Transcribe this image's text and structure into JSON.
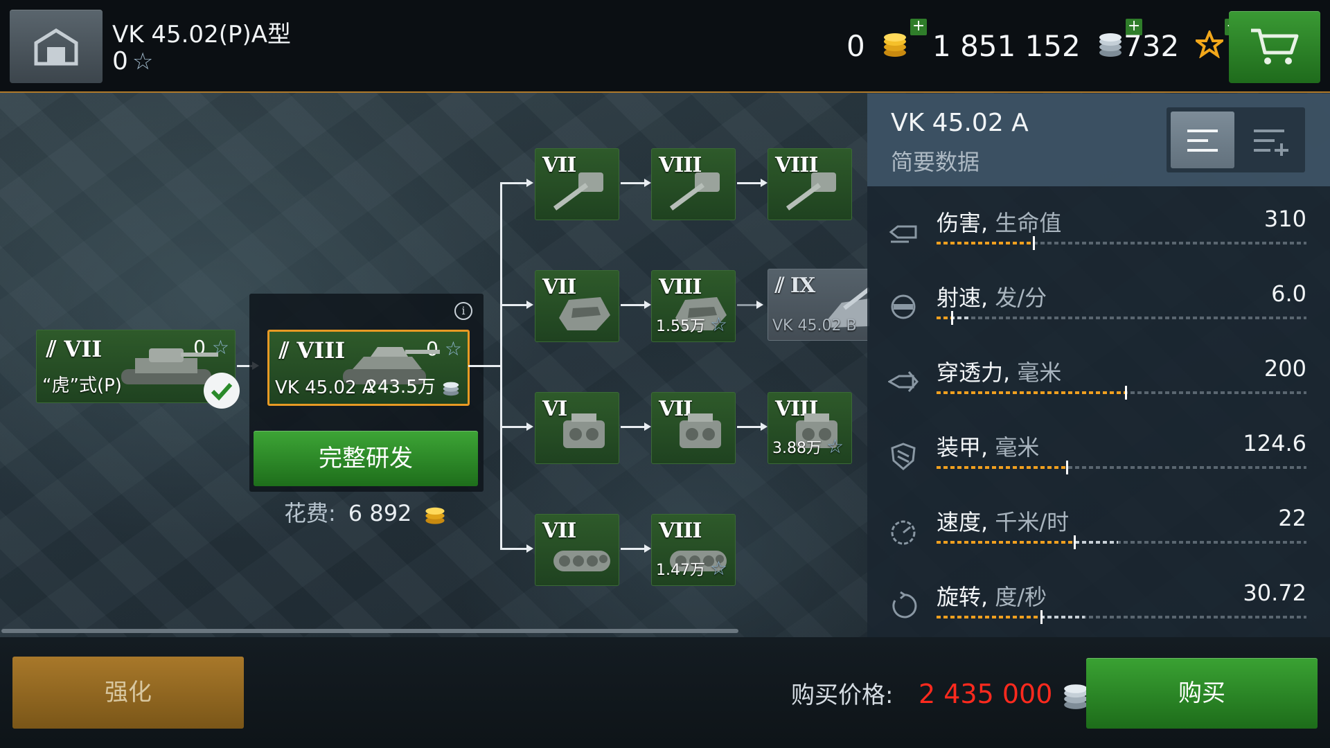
{
  "header": {
    "vehicle_title": "VK 45.02(P)A型",
    "vehicle_xp": "0",
    "gold": "0",
    "credits": "1 851 152",
    "free_xp": "732",
    "plus": "+"
  },
  "tree": {
    "prev_tank": {
      "tier": "VII",
      "name": "“虎”式(P)",
      "xp": "0"
    },
    "current_tank": {
      "tier": "VIII",
      "name": "VK 45.02 A",
      "xp": "0",
      "cost": "243.5万"
    },
    "research_button": "完整研发",
    "cost_label": "花费:",
    "cost_value": "6 892",
    "info": "i",
    "modules": {
      "gun_1": {
        "tier": "VII"
      },
      "gun_2": {
        "tier": "VIII"
      },
      "gun_3": {
        "tier": "VIII"
      },
      "turret_1": {
        "tier": "VII"
      },
      "turret_2": {
        "tier": "VIII",
        "cost": "1.55万"
      },
      "next_tank": {
        "tier": "IX",
        "name": "VK 45.02 B"
      },
      "engine_1": {
        "tier": "VI"
      },
      "engine_2": {
        "tier": "VII"
      },
      "engine_3": {
        "tier": "VIII",
        "cost": "3.88万"
      },
      "tracks_1": {
        "tier": "VII"
      },
      "tracks_2": {
        "tier": "VIII",
        "cost": "1.47万"
      }
    }
  },
  "stats": {
    "title": "VK 45.02 A",
    "subtitle": "简要数据",
    "rows": [
      {
        "label": "伤害",
        "unit": "生命值",
        "value": "310",
        "level": 0.26,
        "next": 0.26,
        "icon": "shell-icon"
      },
      {
        "label": "射速",
        "unit": "发/分",
        "value": "6.0",
        "level": 0.04,
        "next": 0.09,
        "icon": "reload-icon"
      },
      {
        "label": "穿透力",
        "unit": "毫米",
        "value": "200",
        "level": 0.51,
        "next": 0.51,
        "icon": "penetration-icon"
      },
      {
        "label": "装甲",
        "unit": "毫米",
        "value": "124.6",
        "level": 0.35,
        "next": 0.35,
        "icon": "armor-icon"
      },
      {
        "label": "速度",
        "unit": "千米/时",
        "value": "22",
        "level": 0.37,
        "next": 0.49,
        "icon": "speedometer-icon"
      },
      {
        "label": "旋转",
        "unit": "度/秒",
        "value": "30.72",
        "level": 0.28,
        "next": 0.4,
        "icon": "rotation-icon"
      }
    ]
  },
  "bottom": {
    "upgrade_button": "强化",
    "price_label": "购买价格:",
    "price_value": "2 435 000",
    "buy_button": "购买"
  },
  "colors": {
    "accent_orange": "#b07a2a",
    "bar_fill": "#f0a020",
    "price_red": "#ff2a1e",
    "node_green": "#2e5a2a"
  }
}
